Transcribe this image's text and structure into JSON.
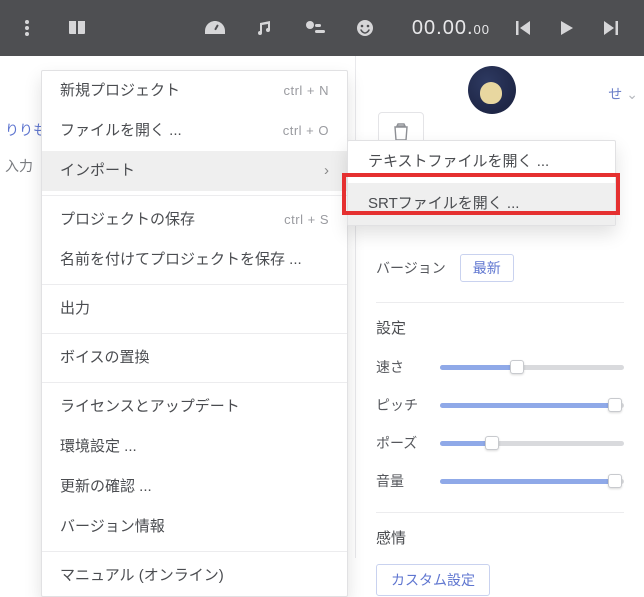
{
  "toolbar": {
    "icons": [
      "more-vertical",
      "book",
      "gauge",
      "music",
      "split",
      "smiley"
    ],
    "time_main": "00.00.",
    "time_frac": "00"
  },
  "left": {
    "crumb1": "りりも",
    "crumb2": "入力"
  },
  "menu": {
    "items": [
      {
        "label": "新規プロジェクト",
        "shortcut": "ctrl + N"
      },
      {
        "label": "ファイルを開く ...",
        "shortcut": "ctrl + O"
      },
      {
        "label": "インポート",
        "submenu": true,
        "hover": true
      },
      "---",
      {
        "label": "プロジェクトの保存",
        "shortcut": "ctrl + S"
      },
      {
        "label": "名前を付けてプロジェクトを保存 ..."
      },
      "---",
      {
        "label": "出力"
      },
      "---",
      {
        "label": "ボイスの置換"
      },
      "---",
      {
        "label": "ライセンスとアップデート"
      },
      {
        "label": "環境設定 ..."
      },
      {
        "label": "更新の確認 ..."
      },
      {
        "label": "バージョン情報"
      },
      "---",
      {
        "label": "マニュアル (オンライン)"
      }
    ]
  },
  "submenu": {
    "items": [
      {
        "label": "テキストファイルを開く ..."
      },
      {
        "label": "SRTファイルを開く ...",
        "hover": true
      }
    ]
  },
  "right_panel": {
    "preset_label": "せ",
    "version_label": "バージョン",
    "version_value": "最新",
    "settings_heading": "設定",
    "sliders": [
      {
        "label": "速さ",
        "pct": 42
      },
      {
        "label": "ピッチ",
        "pct": 95
      },
      {
        "label": "ポーズ",
        "pct": 28
      },
      {
        "label": "音量",
        "pct": 95
      }
    ],
    "emotion_heading": "感情",
    "custom_label": "カスタム設定"
  }
}
